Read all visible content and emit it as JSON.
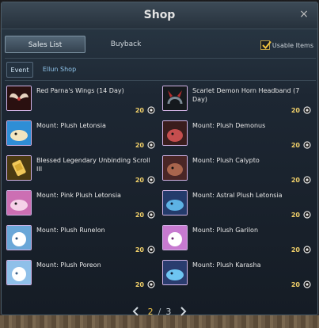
{
  "window": {
    "title": "Shop",
    "close_symbol": "×"
  },
  "tabs": [
    {
      "label": "Sales List",
      "active": true
    },
    {
      "label": "Buyback",
      "active": false
    }
  ],
  "filter": {
    "label": "Usable Items",
    "checked": true
  },
  "subtabs": [
    {
      "label": "Event",
      "active": true
    },
    {
      "label": "Ellun Shop",
      "active": false
    }
  ],
  "items": [
    {
      "name": "Red Parna's Wings (14 Day)",
      "price": "20",
      "icon": "wings-icon",
      "color": "#2a1010",
      "accent": "#d9c6b4"
    },
    {
      "name": "Scarlet Demon Horn Headband (7 Day)",
      "price": "20",
      "icon": "horn-headband-icon",
      "color": "#15191d",
      "accent": "#b52b2b"
    },
    {
      "name": "Mount: Plush Letonsia",
      "price": "20",
      "icon": "plush-letonsia-icon",
      "color": "#2f8ed6",
      "accent": "#f3e5bf"
    },
    {
      "name": "Mount: Plush Demonus",
      "price": "20",
      "icon": "plush-demonus-icon",
      "color": "#3a1d1d",
      "accent": "#c54e4e"
    },
    {
      "name": "Blessed Legendary Unbinding Scroll III",
      "price": "20",
      "icon": "scroll-icon",
      "color": "#4b3a12",
      "accent": "#f1c85a"
    },
    {
      "name": "Mount: Plush Calypto",
      "price": "20",
      "icon": "plush-calypto-icon",
      "color": "#4a2626",
      "accent": "#a9654d"
    },
    {
      "name": "Mount: Pink Plush Letonsia",
      "price": "20",
      "icon": "pink-plush-letonsia-icon",
      "color": "#cc6fb3",
      "accent": "#f5d2e8"
    },
    {
      "name": "Mount: Astral Plush Letonsia",
      "price": "20",
      "icon": "astral-plush-letonsia-icon",
      "color": "#243b6b",
      "accent": "#5db2e4"
    },
    {
      "name": "Mount: Plush Runelon",
      "price": "20",
      "icon": "plush-runelon-icon",
      "color": "#6aa7d8",
      "accent": "#ffffff"
    },
    {
      "name": "Mount: Plush Garilon",
      "price": "20",
      "icon": "plush-garilon-icon",
      "color": "#c77ad0",
      "accent": "#ffffff"
    },
    {
      "name": "Mount: Plush Poreon",
      "price": "20",
      "icon": "plush-poreon-icon",
      "color": "#8fc0e9",
      "accent": "#ffffff"
    },
    {
      "name": "Mount: Plush Karasha",
      "price": "20",
      "icon": "plush-karasha-icon",
      "color": "#2a3c6e",
      "accent": "#6ec5f2"
    }
  ],
  "pagination": {
    "current": "2",
    "separator": "/",
    "total": "3"
  },
  "colors": {
    "price": "#f2d16a",
    "active_page": "#f0c44a",
    "active_subtab_text": "#cfe3f2",
    "link_subtab": "#8ec3ea"
  }
}
